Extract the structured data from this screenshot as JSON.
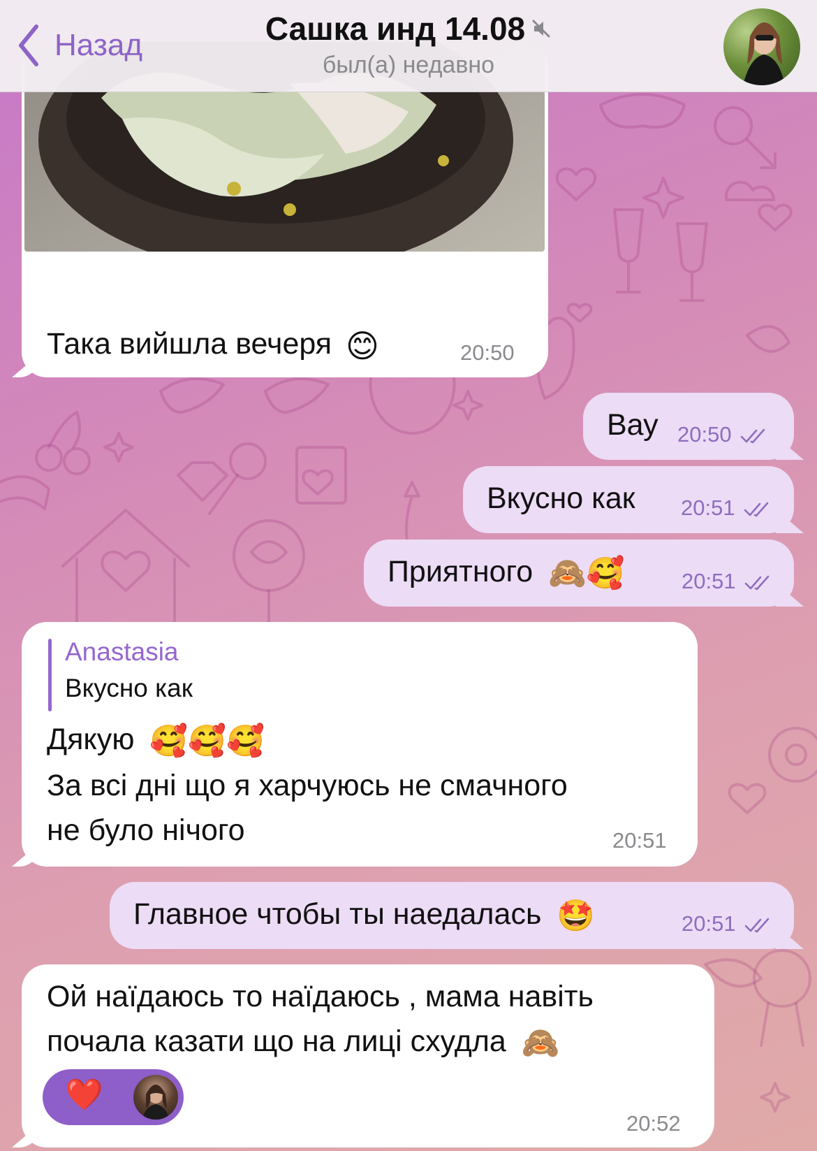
{
  "header": {
    "back_label": "Назад",
    "title": "Сашка инд 14.08",
    "status": "был(а) недавно",
    "muted_icon": "mute-icon"
  },
  "colors": {
    "accent": "#8e63c7",
    "incoming_bubble": "#ffffff",
    "outgoing_bubble": "#ecdcf6",
    "reaction_pill": "#8e5ec9"
  },
  "messages": [
    {
      "direction": "in",
      "text": "Така вийшла вечеря",
      "emoji": "😊",
      "time": "20:50",
      "has_photo": true
    },
    {
      "direction": "out",
      "text": "Вау",
      "time": "20:50",
      "read": true
    },
    {
      "direction": "out",
      "text": "Вкусно как",
      "time": "20:51",
      "read": true
    },
    {
      "direction": "out",
      "text": "Приятного",
      "emoji": "🙈🥰",
      "time": "20:51",
      "read": true
    },
    {
      "direction": "in",
      "reply_to": {
        "name": "Anastasia",
        "text": "Вкусно как"
      },
      "line1": "Дякую",
      "line1_emoji": "🥰🥰🥰",
      "line2": "За всі дні що я харчуюсь не смачного",
      "line3": "не було нічого",
      "time": "20:51"
    },
    {
      "direction": "out",
      "text": "Главное чтобы ты наедалась",
      "emoji": "🤩",
      "time": "20:51",
      "read": true
    },
    {
      "direction": "in",
      "line1": "Ой наїдаюсь то наїдаюсь , мама навіть",
      "line2": "почала казати що на лиці схудла",
      "emoji": "🙈",
      "reaction": "❤️",
      "time": "20:52"
    }
  ]
}
